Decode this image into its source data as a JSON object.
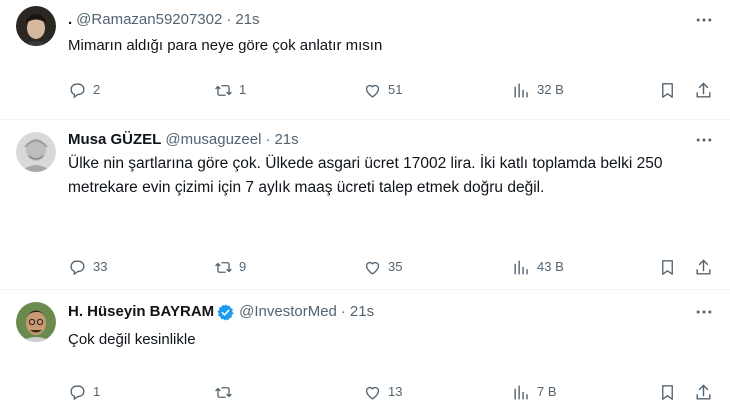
{
  "tweets": [
    {
      "display_name": ".",
      "handle": "@Ramazan59207302",
      "separator": "·",
      "time": "21s",
      "verified": false,
      "text": "Mimarın aldığı para neye göre çok anlatır mısın",
      "replies": "2",
      "retweets": "1",
      "likes": "51",
      "views": "32 B"
    },
    {
      "display_name": "Musa GÜZEL",
      "handle": "@musaguzeel",
      "separator": "·",
      "time": "21s",
      "verified": false,
      "text": "Ülke nin şartlarına göre çok. Ülkede asgari ücret 17002 lira. İki katlı toplamda belki 250 metrekare evin çizimi için 7 aylık maaş ücreti talep etmek doğru değil.",
      "replies": "33",
      "retweets": "9",
      "likes": "35",
      "views": "43 B"
    },
    {
      "display_name": "H. Hüseyin BAYRAM",
      "handle": "@InvestorMed",
      "separator": "·",
      "time": "21s",
      "verified": true,
      "text": "Çok değil kesinlikle",
      "replies": "1",
      "retweets": "",
      "likes": "13",
      "views": "7 B"
    }
  ],
  "icons": {
    "reply": "reply-icon",
    "retweet": "retweet-icon",
    "like": "heart-icon",
    "views": "views-icon",
    "bookmark": "bookmark-icon",
    "share": "share-icon",
    "more": "more-icon",
    "verified": "verified-badge-icon"
  },
  "colors": {
    "text": "#0f1419",
    "secondary": "#536471",
    "verified": "#1d9bf0",
    "divider": "#eff3f4"
  }
}
